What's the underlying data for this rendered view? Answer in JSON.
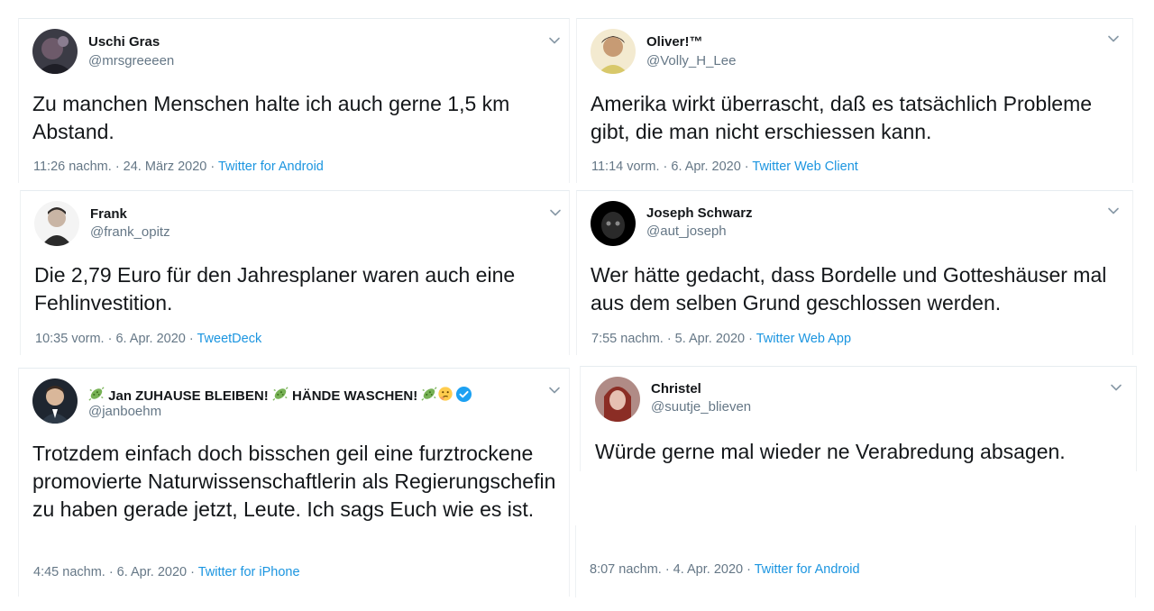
{
  "tweets": [
    {
      "name": "Uschi Gras",
      "handle": "@mrsgreeeen",
      "text": "Zu manchen Menschen halte ich auch gerne 1,5 km Abstand.",
      "time": "11:26 nachm. · 24. März 2020 · ",
      "source": "Twitter for Android"
    },
    {
      "name": "Oliver!™",
      "handle": "@Volly_H_Lee",
      "text": "Amerika wirkt überrascht, daß es tatsächlich Probleme gibt, die man nicht erschiessen kann.",
      "time": "11:14 vorm. · 6. Apr. 2020 · ",
      "source": "Twitter Web Client"
    },
    {
      "name": "Frank",
      "handle": "@frank_opitz",
      "text": "Die 2,79 Euro für den Jahresplaner waren auch eine Fehlinvestition.",
      "time": "10:35 vorm. · 6. Apr. 2020 · ",
      "source": "TweetDeck"
    },
    {
      "name": "Joseph Schwarz",
      "handle": "@aut_joseph",
      "text": "Wer hätte gedacht, dass Bordelle und Gotteshäuser mal aus dem selben Grund geschlossen werden.",
      "time": "7:55 nachm. · 5. Apr. 2020 · ",
      "source": "Twitter Web App"
    },
    {
      "name_part1": " Jan ZUHAUSE BLEIBEN! ",
      "name_part2": " HÄNDE WASCHEN! ",
      "handle": "@janboehm",
      "text": "Trotzdem einfach doch bisschen geil eine furztrockene promovierte Naturwissenschaftlerin als Regierungschefin zu haben gerade jetzt, Leute. Ich sags Euch wie es ist.",
      "time": "4:45 nachm. · 6. Apr. 2020 · ",
      "source": "Twitter for iPhone"
    },
    {
      "name": "Christel",
      "handle": "@suutje_blieven",
      "text": "Würde gerne mal wieder ne Verabredung absagen.",
      "time": "8:07 nachm. · 4. Apr. 2020 · ",
      "source": "Twitter for Android"
    }
  ],
  "colors": {
    "link": "#1b95e0",
    "secondary": "#657786",
    "text": "#14171a",
    "verified": "#1da1f2"
  },
  "icons": {
    "menu": "chevron-down-icon",
    "verified": "verified-badge-icon",
    "emoji": "microbe-emoji-icon"
  }
}
